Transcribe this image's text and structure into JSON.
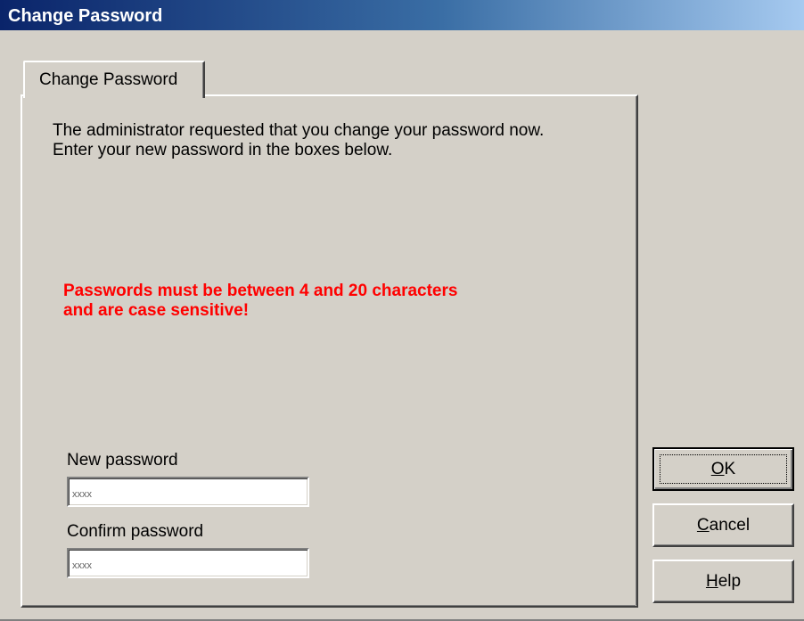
{
  "window": {
    "title": "Change Password"
  },
  "tab": {
    "label": "Change Password"
  },
  "panel": {
    "intro_line1": "The administrator requested that you change your password now.",
    "intro_line2": "Enter your new password in the boxes below.",
    "warning_line1": "Passwords must be between 4 and 20 characters",
    "warning_line2": "and are case sensitive!"
  },
  "fields": {
    "new_password_label": "New password",
    "new_password_value": "xxxx",
    "confirm_password_label": "Confirm password",
    "confirm_password_value": "xxxx"
  },
  "buttons": {
    "ok_mnemonic": "O",
    "ok_rest": "K",
    "cancel_mnemonic": "C",
    "cancel_rest": "ancel",
    "help_mnemonic": "H",
    "help_rest": "elp"
  },
  "colors": {
    "titlebar_start": "#0a246a",
    "titlebar_end": "#a6caf0",
    "warning": "#ff0000",
    "face": "#d4d0c8"
  }
}
